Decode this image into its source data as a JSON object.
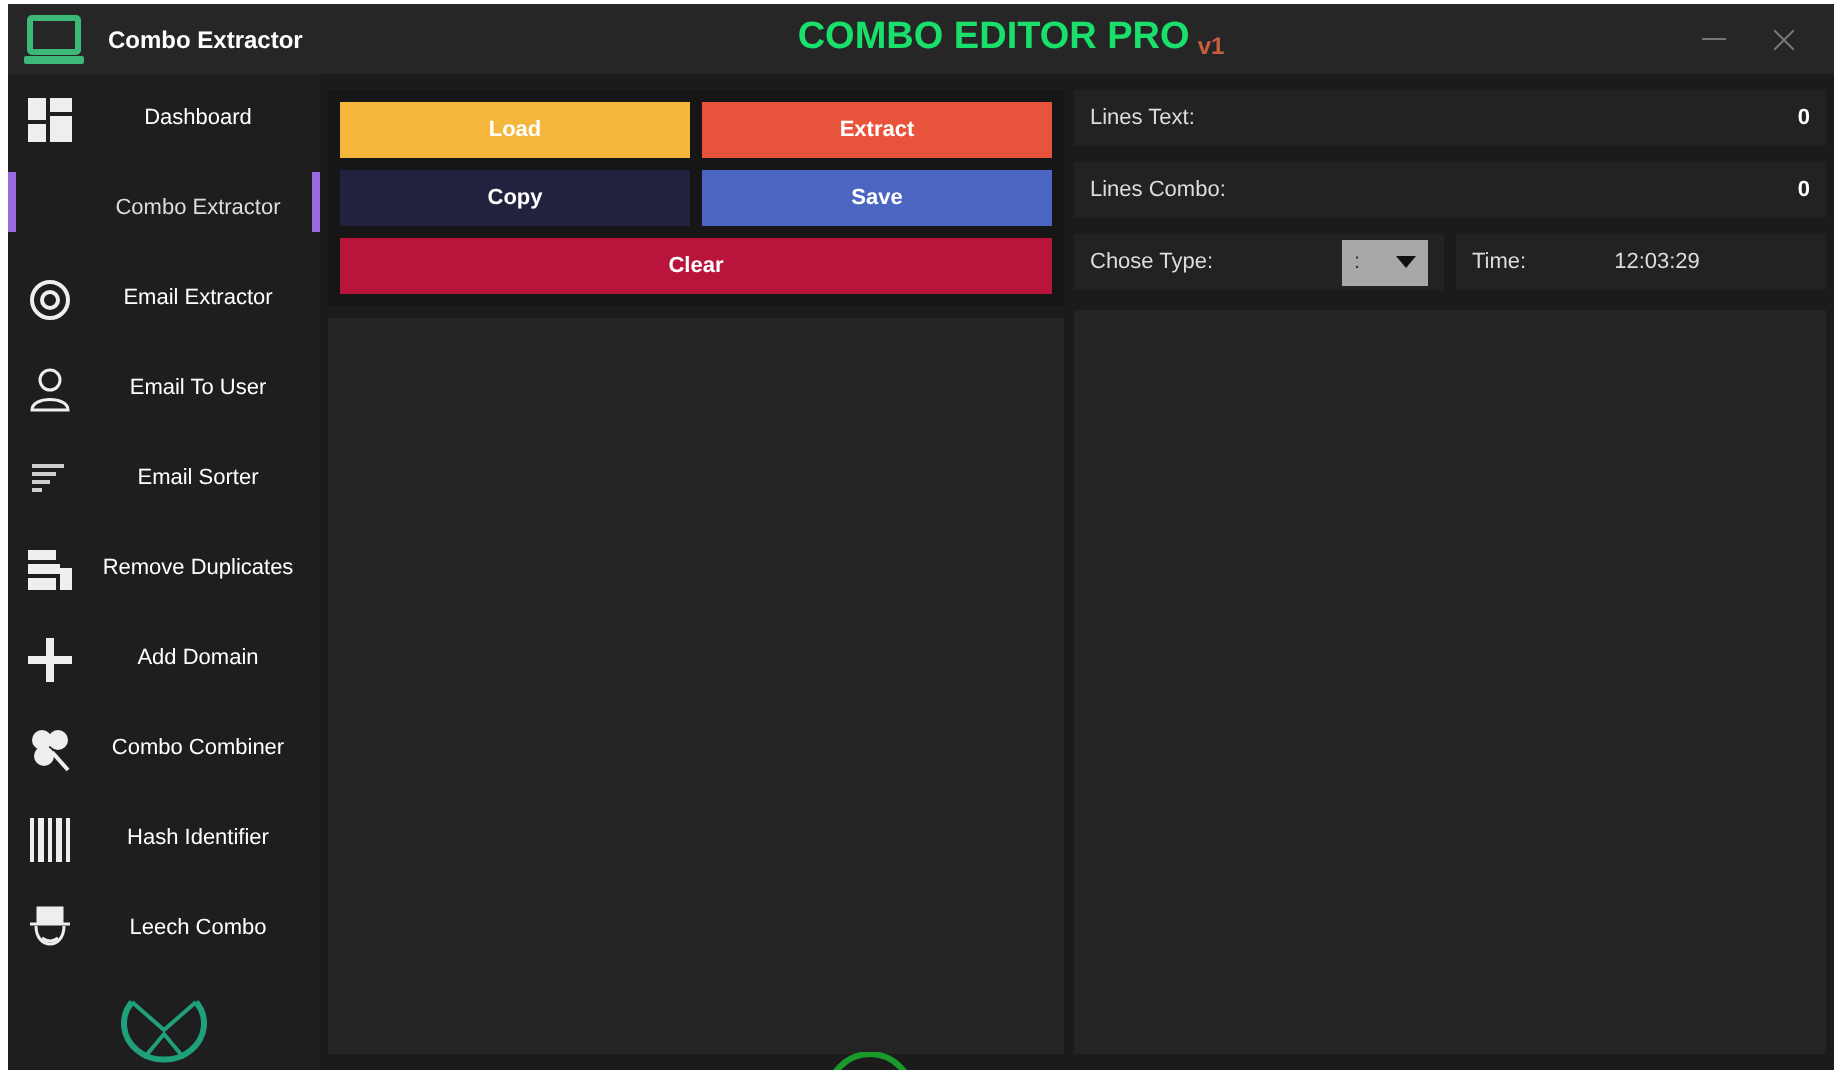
{
  "app": {
    "name": "Combo Extractor"
  },
  "title": {
    "text": "COMBO EDITOR PRO",
    "version": "v1"
  },
  "sidebar": {
    "items": [
      {
        "label": "Dashboard",
        "selected": false
      },
      {
        "label": "Combo Extractor",
        "selected": true
      },
      {
        "label": "Email Extractor",
        "selected": false
      },
      {
        "label": "Email To User",
        "selected": false
      },
      {
        "label": "Email Sorter",
        "selected": false
      },
      {
        "label": "Remove Duplicates",
        "selected": false
      },
      {
        "label": "Add Domain",
        "selected": false
      },
      {
        "label": "Combo Combiner",
        "selected": false
      },
      {
        "label": "Hash Identifier",
        "selected": false
      },
      {
        "label": "Leech Combo",
        "selected": false
      }
    ]
  },
  "buttons": [
    {
      "label": "Load",
      "color": "#f4b63b"
    },
    {
      "label": "Extract",
      "color": "#e8533b"
    },
    {
      "label": "Copy",
      "color": "#22223f"
    },
    {
      "label": "Save",
      "color": "#4a66c0"
    },
    {
      "label": "Clear",
      "color": "#b8143c"
    }
  ],
  "stats": [
    {
      "label": "Lines Text:",
      "value": "0"
    },
    {
      "label": "Lines Combo:",
      "value": "0"
    }
  ],
  "type_select": {
    "label": "Chose Type:",
    "value": ":"
  },
  "time": {
    "label": "Time:",
    "value": "12:03:29"
  }
}
